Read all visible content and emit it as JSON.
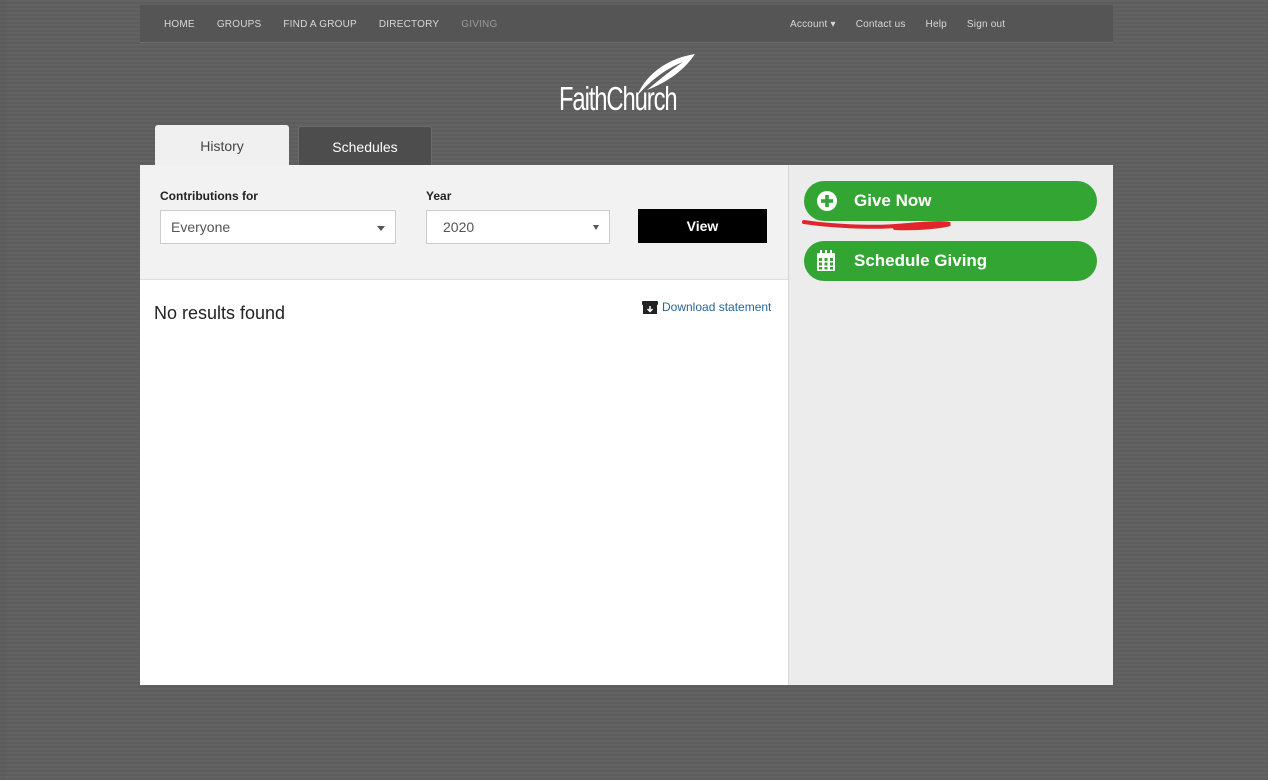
{
  "nav": {
    "left": [
      "HOME",
      "GROUPS",
      "FIND A GROUP",
      "DIRECTORY",
      "GIVING"
    ],
    "right": [
      "Account ▾",
      "Contact us",
      "Help",
      "Sign out"
    ]
  },
  "logo": {
    "text": "FaithChurch"
  },
  "tabs": [
    {
      "label": "History",
      "active": true
    },
    {
      "label": "Schedules",
      "active": false
    }
  ],
  "filters": {
    "contributions_label": "Contributions for",
    "contributions_value": "Everyone",
    "year_label": "Year",
    "year_value": "2020",
    "view_button": "View"
  },
  "results": {
    "message": "No results found",
    "download_label": "Download statement"
  },
  "sidebar": {
    "give_now": "Give Now",
    "schedule_giving": "Schedule Giving"
  },
  "colors": {
    "accent_green": "#33a532",
    "annotation_red": "#e0262c",
    "link_blue": "#2a6496"
  }
}
